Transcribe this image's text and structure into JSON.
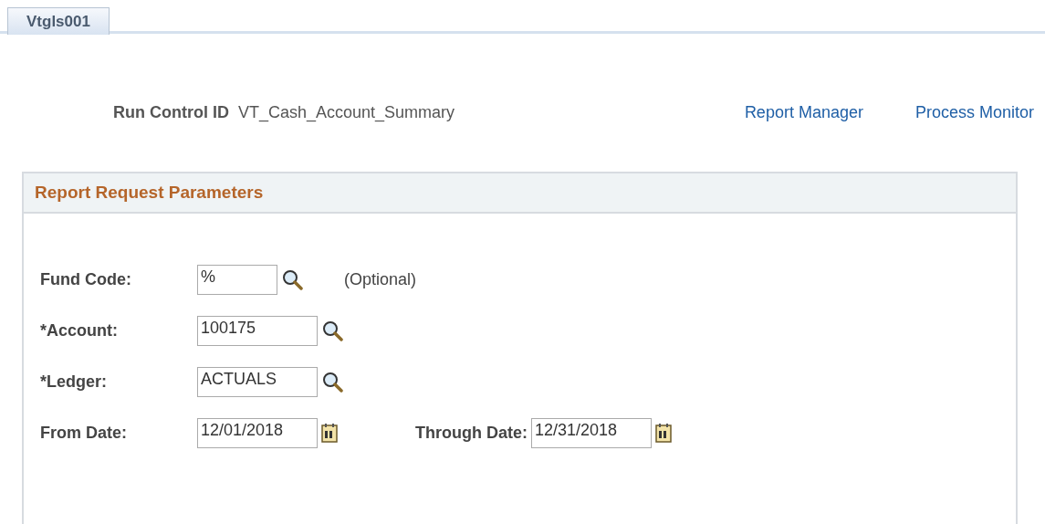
{
  "tabs": [
    {
      "label": "Vtgls001",
      "selected": true
    }
  ],
  "run_control": {
    "label": "Run Control ID",
    "value": "VT_Cash_Account_Summary"
  },
  "links": [
    "Report Manager",
    "Process Monitor"
  ],
  "panel": {
    "title": "Report Request Parameters",
    "rows": [
      {
        "fields": [
          {
            "label": "Fund Code:",
            "value": "%",
            "kind": "short_lookup",
            "note": "(Optional)"
          }
        ]
      },
      {
        "fields": [
          {
            "label": "*Account:",
            "value": "100175",
            "kind": "lookup"
          }
        ]
      },
      {
        "fields": [
          {
            "label": "*Ledger:",
            "value": "ACTUALS",
            "kind": "lookup"
          }
        ]
      },
      {
        "fields": [
          {
            "label": "From Date:",
            "value": "12/01/2018",
            "kind": "date"
          },
          {
            "label": "Through Date:",
            "value": "12/31/2018",
            "kind": "date"
          }
        ]
      }
    ]
  }
}
